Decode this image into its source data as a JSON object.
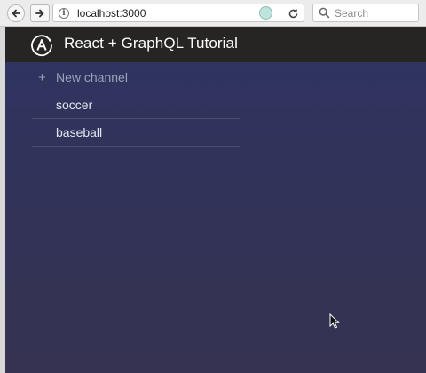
{
  "browser": {
    "url": "localhost:3000",
    "search_placeholder": "Search"
  },
  "app": {
    "title": "React + GraphQL Tutorial",
    "logo_letter": "A"
  },
  "channels": {
    "new_label": "New channel",
    "new_icon": "+",
    "items": [
      {
        "label": "soccer"
      },
      {
        "label": "baseball"
      }
    ]
  },
  "colors": {
    "header_bg": "#262524",
    "main_bg": "#323356"
  }
}
